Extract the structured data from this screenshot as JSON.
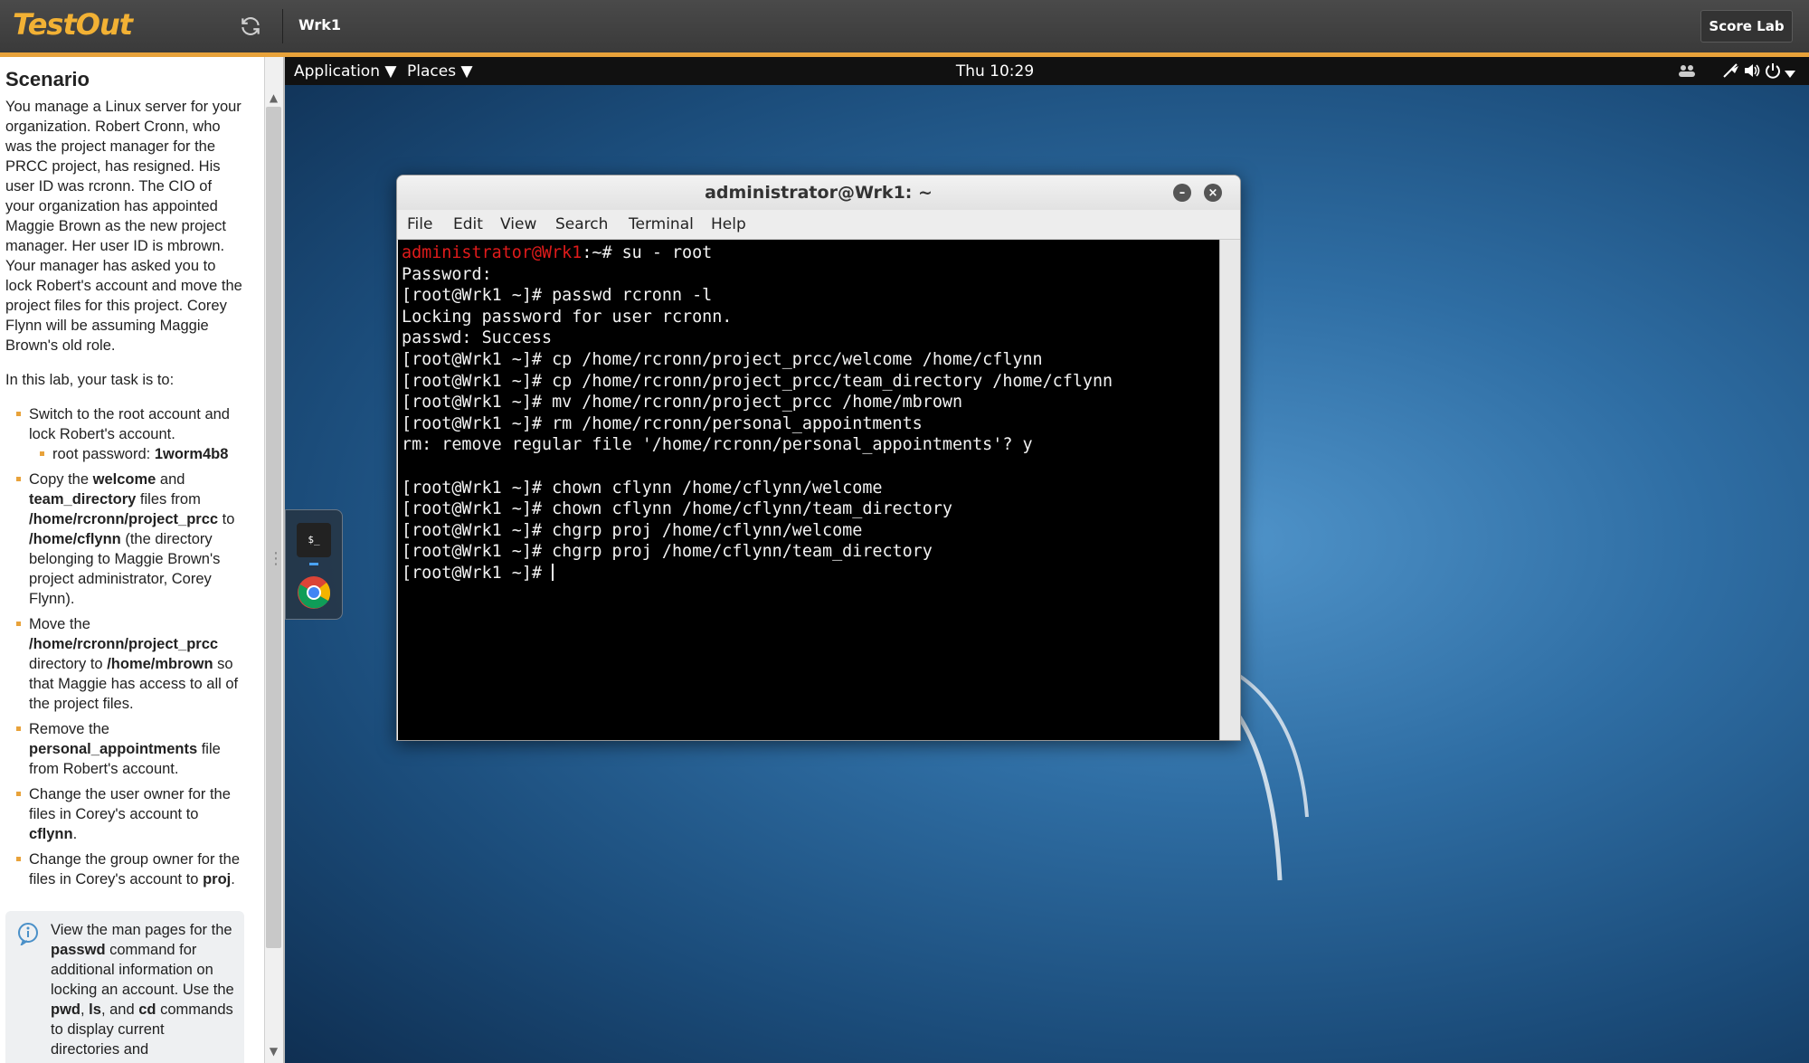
{
  "topbar": {
    "logo": "TestOut",
    "title": "Wrk1",
    "score_label": "Score Lab",
    "accent_color": "#e8a23a",
    "logo_color": "#f2b134"
  },
  "scenario": {
    "heading": "Scenario",
    "intro": "You manage a Linux server for your organization. Robert Cronn, who was the project manager for the PRCC project, has resigned. His user ID was rcronn. The CIO of your organization has appointed Maggie Brown as the new project manager. Her user ID is mbrown. Your manager has asked you to lock Robert's account and move the project files for this project. Corey Flynn will be assuming Maggie Brown's old role.",
    "task_intro": "In this lab, your task is to:",
    "tasks": [
      {
        "t1": "Switch to the root account and lock Robert's account."
      },
      {
        "sub_label": "root password: ",
        "sub_value": "1worm4b8"
      },
      {
        "a": "Copy the ",
        "b": "welcome",
        "c": " and ",
        "d": "team_directory",
        "e": " files from ",
        "f": "/home/rcronn/project_prcc",
        "g": " to ",
        "h": "/home/cflynn",
        "i": " (the directory belonging to Maggie Brown's project administrator, Corey Flynn)."
      },
      {
        "a": "Move the ",
        "b": "/home/rcronn/project_prcc",
        "c": " directory to ",
        "d": "/home/mbrown",
        "e": " so that Maggie has access to all of the project files."
      },
      {
        "a": "Remove the ",
        "b": "personal_appointments",
        "c": " file from Robert's account."
      },
      {
        "a": "Change the user owner for the files in Corey's account to ",
        "b": "cflynn",
        "c": "."
      },
      {
        "a": "Change the group owner for the files in Corey's account to ",
        "b": "proj",
        "c": "."
      }
    ],
    "info": {
      "a": "View the man pages for the ",
      "b": "passwd",
      "c": " command for additional information on locking an account. Use the ",
      "d": "pwd",
      "e": ", ",
      "f": "ls",
      "g": ", and ",
      "h": "cd",
      "i": " commands to display current directories and"
    }
  },
  "gnome": {
    "application": "Application ▼",
    "places": "Places ▼",
    "clock": "Thu 10:29"
  },
  "dock": {
    "terminal_label": "$_"
  },
  "terminal": {
    "title": "administrator@Wrk1: ~",
    "menu": [
      "File",
      "Edit",
      "View",
      "Search",
      "Terminal",
      "Help"
    ],
    "first_prompt_user": "administrator@Wrk1",
    "first_prompt_rest": ":~# su - root",
    "lines": [
      "Password:",
      "[root@Wrk1 ~]# passwd rcronn -l",
      "Locking password for user rcronn.",
      "passwd: Success",
      "[root@Wrk1 ~]# cp /home/rcronn/project_prcc/welcome /home/cflynn",
      "[root@Wrk1 ~]# cp /home/rcronn/project_prcc/team_directory /home/cflynn",
      "[root@Wrk1 ~]# mv /home/rcronn/project_prcc /home/mbrown",
      "[root@Wrk1 ~]# rm /home/rcronn/personal_appointments",
      "rm: remove regular file '/home/rcronn/personal_appointments'? y",
      "",
      "[root@Wrk1 ~]# chown cflynn /home/cflynn/welcome",
      "[root@Wrk1 ~]# chown cflynn /home/cflynn/team_directory",
      "[root@Wrk1 ~]# chgrp proj /home/cflynn/welcome",
      "[root@Wrk1 ~]# chgrp proj /home/cflynn/team_directory"
    ],
    "last_prompt": "[root@Wrk1 ~]# ",
    "prompt_color": "#e01b1b"
  }
}
